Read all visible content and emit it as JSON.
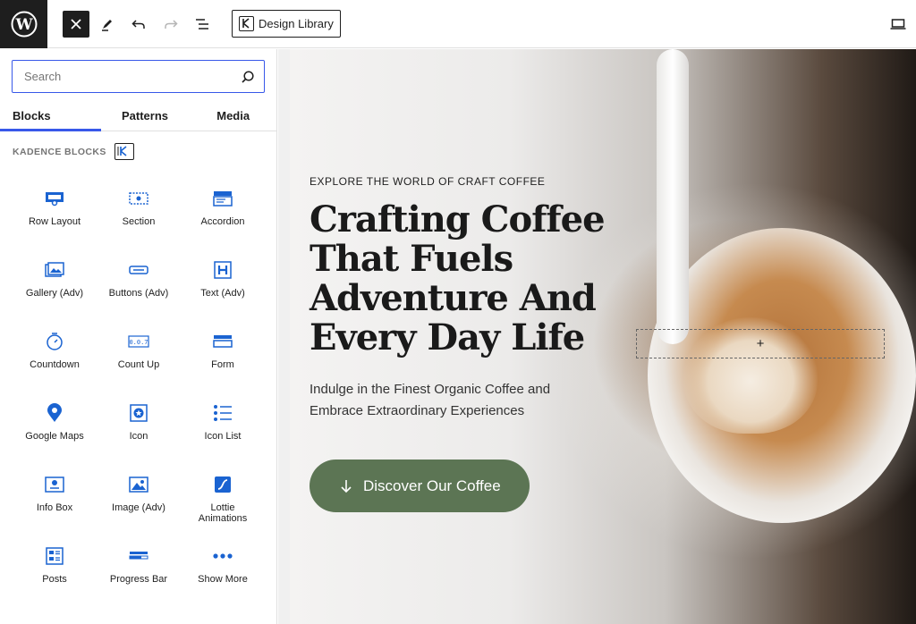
{
  "toolbar": {
    "design_library_label": "Design Library"
  },
  "sidebar": {
    "search": {
      "placeholder": "Search",
      "value": ""
    },
    "tabs": [
      {
        "label": "Blocks",
        "active": true
      },
      {
        "label": "Patterns",
        "active": false
      },
      {
        "label": "Media",
        "active": false
      }
    ],
    "category_title": "KADENCE BLOCKS",
    "blocks": [
      {
        "label": "Row Layout",
        "icon": "row-layout-icon"
      },
      {
        "label": "Section",
        "icon": "section-icon"
      },
      {
        "label": "Accordion",
        "icon": "accordion-icon"
      },
      {
        "label": "Gallery (Adv)",
        "icon": "gallery-icon"
      },
      {
        "label": "Buttons (Adv)",
        "icon": "buttons-icon"
      },
      {
        "label": "Text (Adv)",
        "icon": "text-heading-icon"
      },
      {
        "label": "Countdown",
        "icon": "countdown-icon"
      },
      {
        "label": "Count Up",
        "icon": "count-up-icon"
      },
      {
        "label": "Form",
        "icon": "form-icon"
      },
      {
        "label": "Google Maps",
        "icon": "map-pin-icon"
      },
      {
        "label": "Icon",
        "icon": "icon-block-icon"
      },
      {
        "label": "Icon List",
        "icon": "icon-list-icon"
      },
      {
        "label": "Info Box",
        "icon": "info-box-icon"
      },
      {
        "label": "Image (Adv)",
        "icon": "image-icon"
      },
      {
        "label": "Lottie\nAnimations",
        "icon": "lottie-icon"
      },
      {
        "label": "Posts",
        "icon": "posts-icon"
      },
      {
        "label": "Progress Bar",
        "icon": "progress-bar-icon"
      },
      {
        "label": "Show More",
        "icon": "show-more-icon"
      }
    ]
  },
  "hero": {
    "eyebrow": "EXPLORE THE WORLD OF CRAFT COFFEE",
    "headline": "Crafting Coffee That Fuels Adventure And Every Day Life",
    "subheading": "Indulge in the Finest Organic Coffee and Embrace Extraordinary Experiences",
    "cta_label": "Discover Our Coffee",
    "placeholder_symbol": "+"
  },
  "colors": {
    "accent": "#3858e9",
    "icon_blue": "#1a63d1",
    "cta_green": "#5c7554",
    "dark": "#1e1e1e"
  }
}
